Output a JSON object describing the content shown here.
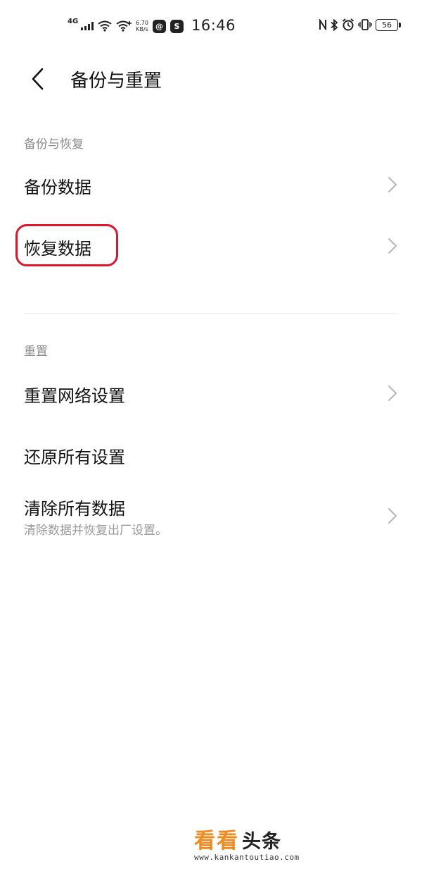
{
  "status_bar": {
    "network_type": "4G",
    "net_speed_value": "6.70",
    "net_speed_unit": "KB/s",
    "time": "16:46",
    "battery": "56",
    "icons": [
      "signal-icon",
      "wifi-icon",
      "wifi-plus-icon",
      "app-icon-1",
      "app-icon-2",
      "nfc-icon",
      "bluetooth-icon",
      "alarm-icon",
      "vibrate-icon",
      "battery-icon"
    ]
  },
  "header": {
    "title": "备份与重置"
  },
  "sections": [
    {
      "label": "备份与恢复",
      "items": [
        {
          "label": "备份数据",
          "has_chevron": true
        },
        {
          "label": "恢复数据",
          "has_chevron": true,
          "highlighted": true
        }
      ]
    },
    {
      "label": "重置",
      "items": [
        {
          "label": "重置网络设置",
          "has_chevron": true
        },
        {
          "label": "还原所有设置",
          "has_chevron": false
        },
        {
          "label": "清除所有数据",
          "subtitle": "清除数据并恢复出厂设置。",
          "has_chevron": true
        }
      ]
    }
  ],
  "colors": {
    "highlight": "#e0152b",
    "section_label": "#8a8a8a",
    "watermark_accent": "#f08a1b"
  },
  "watermark": {
    "text_accent": "看看",
    "text_dark": "头条",
    "url": "www.kankantoutiao.com"
  }
}
